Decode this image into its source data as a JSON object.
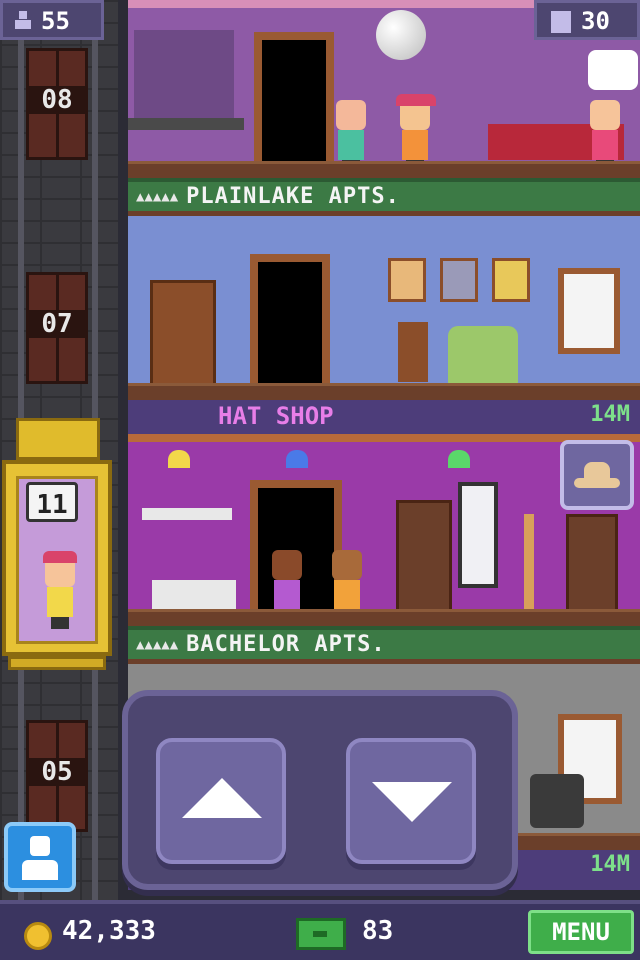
{
  "hud": {
    "population": "55",
    "floors": "30",
    "coins": "42,333",
    "tower_bux": "83",
    "menu_label": "MENU"
  },
  "shaft": {
    "floor_labels": [
      "08",
      "07",
      "05"
    ]
  },
  "elevator": {
    "current_floor": "11"
  },
  "floors": {
    "top_sign": "PLAINLAKE APTS.",
    "shop_name": "HAT SHOP",
    "shop_stock": "14M",
    "lower_sign": "BACHELOR APTS.",
    "bottom_stock": "14M",
    "apt_stars": "▲▲▲▲▲"
  },
  "colors": {
    "accent_green": "#3fae4a",
    "hud_purple": "#4d4670",
    "shop_text_pink": "#e87ee8",
    "stock_green": "#7de08a"
  },
  "icons": {
    "population": "person-icon",
    "floors": "building-icon",
    "coins": "coin-icon",
    "bux": "tower-bux-icon",
    "people_button": "person-icon",
    "up": "up-arrow-icon",
    "down": "down-arrow-icon",
    "hat": "hat-icon"
  }
}
